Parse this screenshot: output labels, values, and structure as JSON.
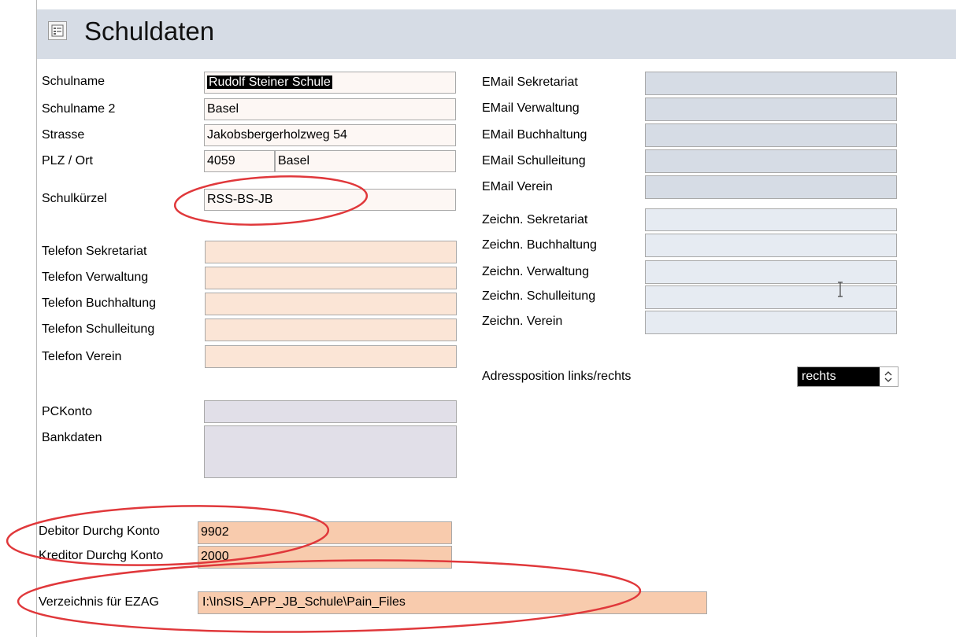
{
  "form": {
    "title": "Schuldaten",
    "icon": "form-icon"
  },
  "left": {
    "schulname": {
      "label": "Schulname",
      "value": "Rudolf Steiner Schule"
    },
    "schulname2": {
      "label": "Schulname 2",
      "value": "Basel"
    },
    "strasse": {
      "label": "Strasse",
      "value": "Jakobsbergerholzweg 54"
    },
    "plz_ort": {
      "label": "PLZ / Ort",
      "plz": "4059",
      "ort": "Basel"
    },
    "schulkuerzel": {
      "label": "Schulkürzel",
      "value": "RSS-BS-JB"
    },
    "telefon_sekretariat": {
      "label": "Telefon Sekretariat",
      "value": ""
    },
    "telefon_verwaltung": {
      "label": "Telefon Verwaltung",
      "value": ""
    },
    "telefon_buchhaltung": {
      "label": "Telefon Buchhaltung",
      "value": ""
    },
    "telefon_schulleitung": {
      "label": "Telefon Schulleitung",
      "value": ""
    },
    "telefon_verein": {
      "label": "Telefon Verein",
      "value": ""
    },
    "pckonto": {
      "label": "PCKonto",
      "value": ""
    },
    "bankdaten": {
      "label": "Bankdaten",
      "value": ""
    },
    "debitor": {
      "label": "Debitor Durchg Konto",
      "value": "9902"
    },
    "kreditor": {
      "label": "Kreditor Durchg Konto",
      "value": "2000"
    },
    "verzeichnis": {
      "label": "Verzeichnis für EZAG",
      "value": "I:\\InSIS_APP_JB_Schule\\Pain_Files"
    }
  },
  "right": {
    "email_sekretariat": {
      "label": "EMail Sekretariat",
      "value": ""
    },
    "email_verwaltung": {
      "label": "EMail Verwaltung",
      "value": ""
    },
    "email_buchhaltung": {
      "label": "EMail Buchhaltung",
      "value": ""
    },
    "email_schulleitung": {
      "label": "EMail Schulleitung",
      "value": ""
    },
    "email_verein": {
      "label": "EMail Verein",
      "value": ""
    },
    "zeichn_sekretariat": {
      "label": "Zeichn. Sekretariat",
      "value": ""
    },
    "zeichn_buchhaltung": {
      "label": "Zeichn. Buchhaltung",
      "value": ""
    },
    "zeichn_verwaltung": {
      "label": "Zeichn. Verwaltung",
      "value": ""
    },
    "zeichn_schulleitung": {
      "label": "Zeichn. Schulleitung",
      "value": ""
    },
    "zeichn_verein": {
      "label": "Zeichn. Verein",
      "value": ""
    },
    "adressposition": {
      "label": "Adressposition links/rechts",
      "value": "rechts"
    }
  },
  "annotations": {
    "color": "#e0383b"
  }
}
